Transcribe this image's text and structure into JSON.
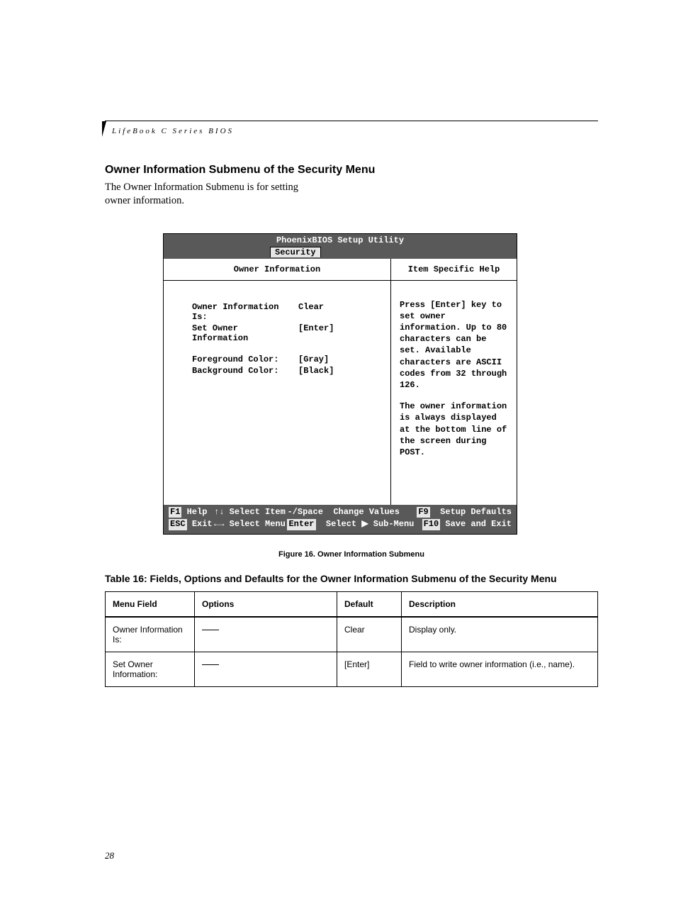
{
  "header": {
    "series": "LifeBook C Series BIOS"
  },
  "section": {
    "heading": "Owner Information Submenu of the Security Menu",
    "intro": "The Owner Information Submenu is for setting owner information."
  },
  "bios": {
    "title": "PhoenixBIOS Setup Utility",
    "tab": "Security",
    "panel_title": "Owner Information",
    "help_title": "Item Specific Help",
    "rows": [
      {
        "label": "Owner Information Is:",
        "value": "Clear"
      },
      {
        "label": "Set Owner Information",
        "value": "[Enter]"
      },
      {
        "label": "Foreground Color:",
        "value": "[Gray]"
      },
      {
        "label": "Background Color:",
        "value": "[Black]"
      }
    ],
    "help_p1": "Press [Enter] key to set owner information. Up to 80 characters can be set. Available characters are ASCII codes from 32 through 126.",
    "help_p2": "The owner information is always displayed at the bottom line of the screen during POST.",
    "footer": {
      "f1": "F1",
      "help": "Help",
      "updown": "↑↓",
      "select_item": "Select Item",
      "minus": "-/Space",
      "change": "Change Values",
      "f9": "F9",
      "defaults": "Setup Defaults",
      "esc": "ESC",
      "exit": "Exit",
      "lr": "←→",
      "select_menu": "Select Menu",
      "enter": "Enter",
      "submenu": "Select ▶ Sub-Menu",
      "f10": "F10",
      "save": "Save and Exit"
    }
  },
  "figure_caption": "Figure 16.  Owner Information Submenu",
  "table_caption": "Table 16: Fields, Options and Defaults for the Owner Information Submenu of the Security Menu",
  "table": {
    "headers": {
      "field": "Menu Field",
      "options": "Options",
      "default": "Default",
      "desc": "Description"
    },
    "rows": [
      {
        "field": "Owner Information Is:",
        "options": "—",
        "default": "Clear",
        "desc": "Display only."
      },
      {
        "field": "Set Owner Information:",
        "options": "—",
        "default": "[Enter]",
        "desc": "Field to write owner information (i.e., name)."
      }
    ]
  },
  "page_number": "28"
}
